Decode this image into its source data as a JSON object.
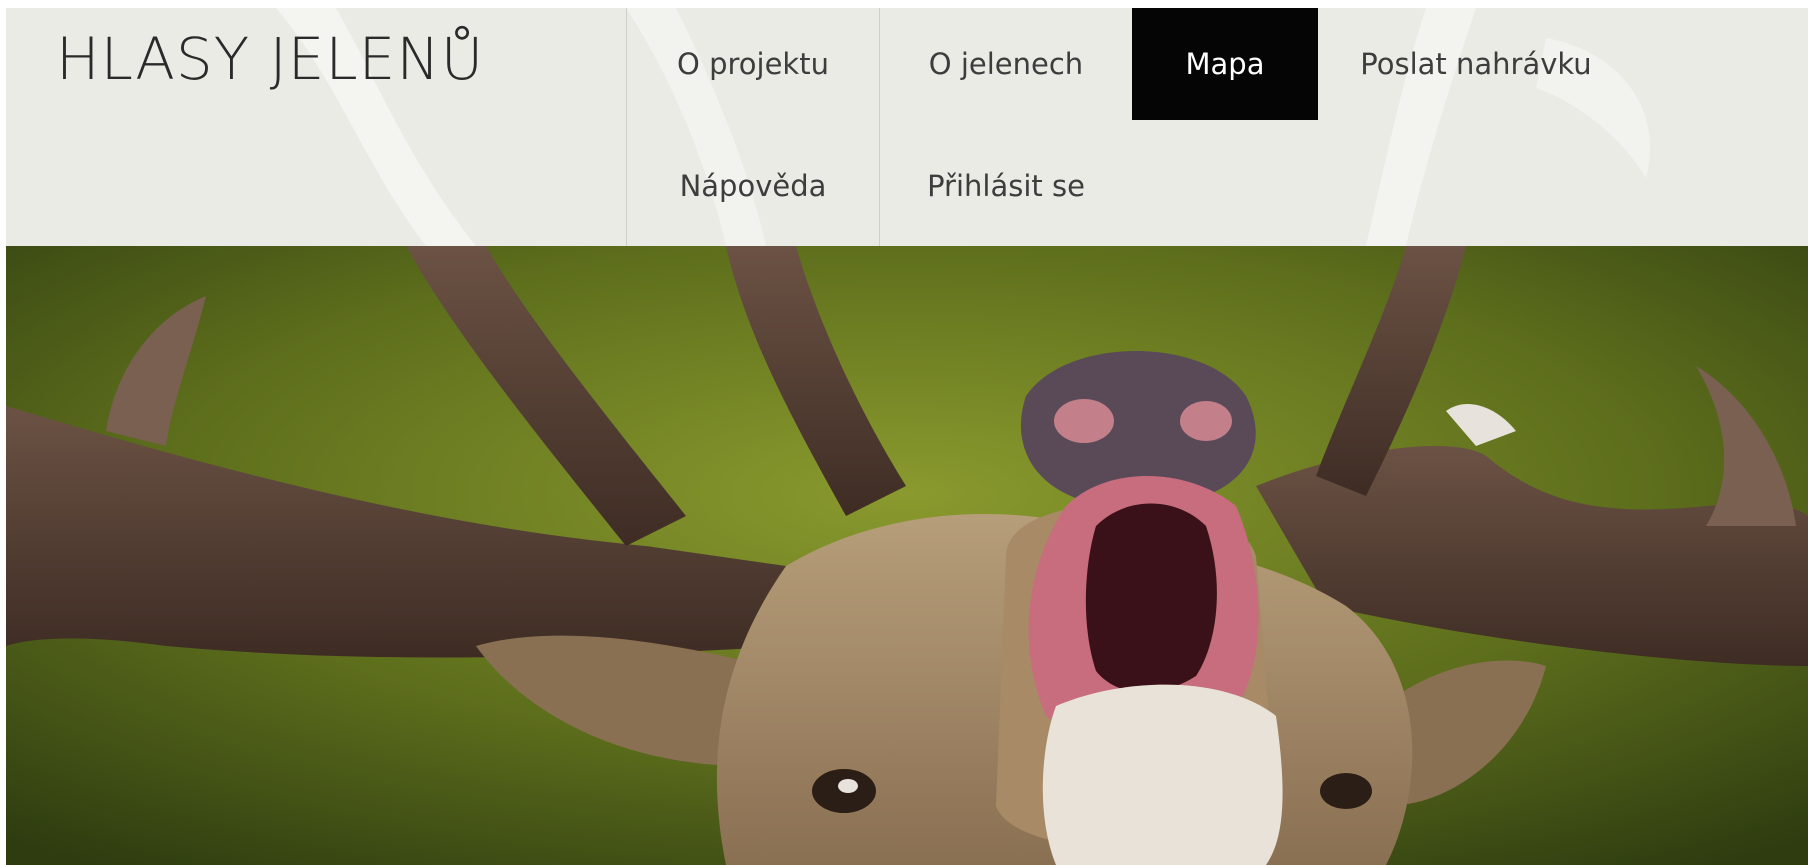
{
  "site": {
    "title": "HLASY JELENŮ"
  },
  "nav": {
    "items": [
      {
        "label": "O projektu",
        "active": false
      },
      {
        "label": "O jelenech",
        "active": false
      },
      {
        "label": "Mapa",
        "active": true
      },
      {
        "label": "Poslat nahrávku",
        "active": false
      },
      {
        "label": "Nápověda",
        "active": false
      },
      {
        "label": "Přihlásit se",
        "active": false
      }
    ]
  },
  "hero": {
    "image": "roaring-red-deer-stag",
    "colors": {
      "background_dark": "#3a4a14",
      "background_light": "#8a9a2e",
      "antler": "#5a4236",
      "fur": "#9c8567",
      "mouth": "#c76d7d"
    }
  },
  "theme": {
    "header_bg": "#ebebe6",
    "active_bg": "#050505",
    "active_text": "#ffffff",
    "text": "#3d3d3d"
  }
}
